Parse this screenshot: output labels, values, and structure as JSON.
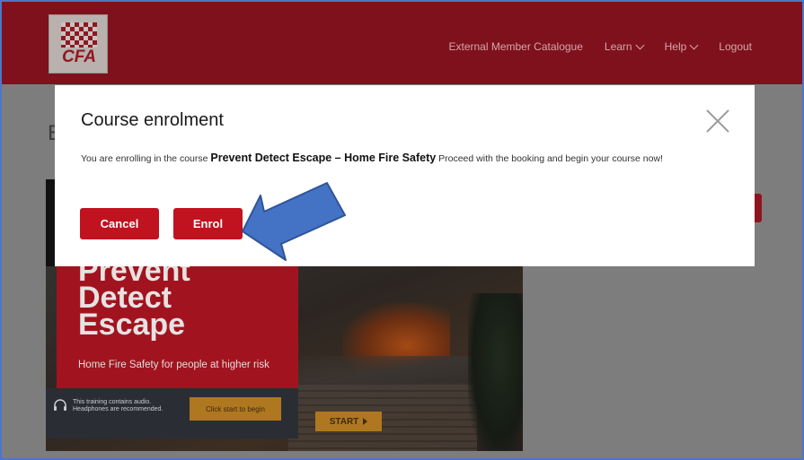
{
  "header": {
    "logo_text": "CFA",
    "nav": [
      {
        "label": "External Member Catalogue",
        "has_dropdown": false
      },
      {
        "label": "Learn",
        "has_dropdown": true
      },
      {
        "label": "Help",
        "has_dropdown": true
      },
      {
        "label": "Logout",
        "has_dropdown": false
      }
    ]
  },
  "page": {
    "heading_peek": "E"
  },
  "modal": {
    "title": "Course enrolment",
    "body_prefix": "You are enrolling in the course",
    "course_name": "Prevent Detect Escape – Home Fire Safety",
    "body_suffix": "Proceed with the booking and begin your course now!",
    "cancel_label": "Cancel",
    "enrol_label": "Enrol"
  },
  "banner": {
    "title_lines": [
      "Prevent",
      "Detect",
      "Escape"
    ],
    "subtitle": "Home Fire Safety for people at higher risk",
    "audio_lines": [
      "This training contains audio.",
      "Headphones are recommended."
    ],
    "click_start": "Click start to begin",
    "start_label": "START"
  },
  "colors": {
    "brand_red": "#c1121f",
    "annotation_arrow": "#4472c4"
  }
}
